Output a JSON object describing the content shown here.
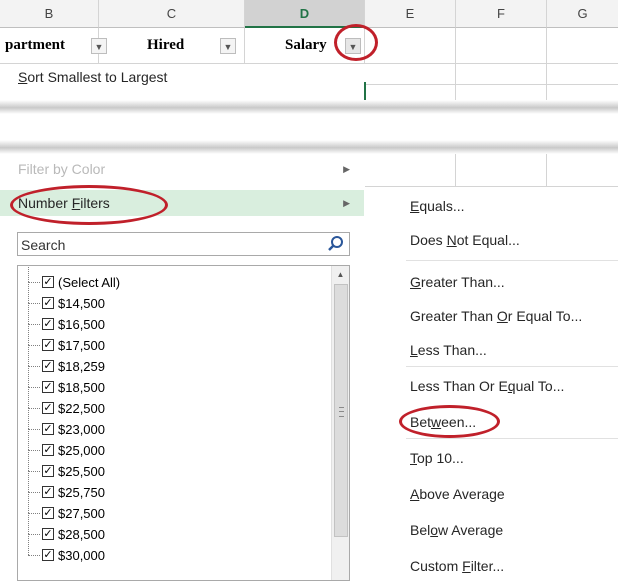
{
  "columns": [
    {
      "letter": "B"
    },
    {
      "letter": "C"
    },
    {
      "letter": "D",
      "selected": true
    },
    {
      "letter": "E"
    },
    {
      "letter": "F"
    },
    {
      "letter": "G"
    }
  ],
  "header_row": {
    "department": "partment",
    "hired": "Hired",
    "salary": "Salary",
    "dropdown_glyph": "▼"
  },
  "menu": {
    "sort_smallest": "Sort Smallest to Largest",
    "sort_smallest_ul": "S",
    "sort_smallest_rest": "ort Smallest to Largest",
    "filter_by_color": "Filter by Color",
    "number_filters_ul": "F",
    "number_filters_pre": "Number ",
    "number_filters_post": "ilters",
    "submenu_arrow": "▶"
  },
  "search": {
    "placeholder": "Search",
    "icon": "search-icon"
  },
  "list": {
    "items": [
      "(Select All)",
      "$14,500",
      "$16,500",
      "$17,500",
      "$18,259",
      "$18,500",
      "$22,500",
      "$23,000",
      "$25,000",
      "$25,500",
      "$25,750",
      "$27,500",
      "$28,500",
      "$30,000"
    ],
    "check_glyph": "✓"
  },
  "scrollbar": {
    "up_glyph": "▲"
  },
  "submenu": {
    "items": [
      {
        "pre": "",
        "ul": "E",
        "post": "quals..."
      },
      {
        "pre": "Does ",
        "ul": "N",
        "post": "ot Equal..."
      },
      {
        "pre": "",
        "ul": "G",
        "post": "reater Than..."
      },
      {
        "pre": "Greater Than ",
        "ul": "O",
        "post": "r Equal To..."
      },
      {
        "pre": "",
        "ul": "L",
        "post": "ess Than..."
      },
      {
        "pre": "Less Than Or E",
        "ul": "q",
        "post": "ual To..."
      },
      {
        "pre": "Bet",
        "ul": "w",
        "post": "een..."
      },
      {
        "pre": "",
        "ul": "T",
        "post": "op 10..."
      },
      {
        "pre": "",
        "ul": "A",
        "post": "bove Average"
      },
      {
        "pre": "Bel",
        "ul": "o",
        "post": "w Average"
      },
      {
        "pre": "Custom ",
        "ul": "F",
        "post": "ilter..."
      }
    ]
  },
  "colors": {
    "accent": "#217346",
    "highlight": "#d9eede",
    "annotation": "#c0202a"
  }
}
